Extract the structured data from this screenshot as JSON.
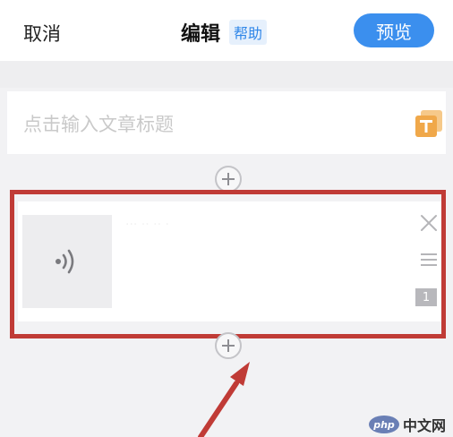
{
  "header": {
    "cancel_label": "取消",
    "title": "编辑",
    "help_label": "帮助",
    "preview_label": "预览"
  },
  "editor": {
    "title_placeholder": "点击输入文章标题"
  },
  "card": {
    "faint_text": "··· ·· ·· ·",
    "order_badge": "1"
  },
  "watermark": {
    "logo": "php",
    "text": "中文网"
  },
  "colors": {
    "accent": "#3b8fee",
    "highlight": "#c03b36",
    "help_text": "#2f86e8"
  },
  "icons": {
    "title_tool": "text-style-icon",
    "block": "audio-icon",
    "add": "plus-icon",
    "delete": "close-icon",
    "reorder": "menu-icon"
  }
}
